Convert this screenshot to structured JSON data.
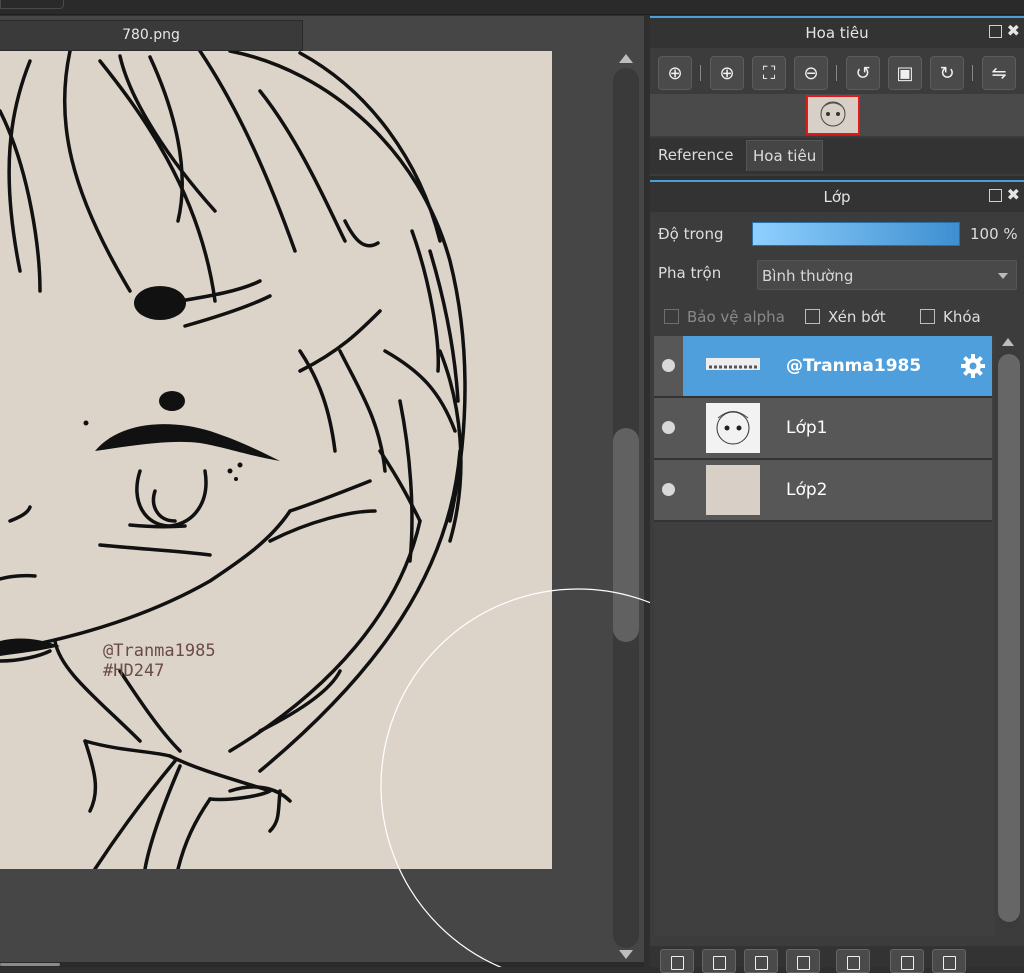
{
  "document": {
    "tab_title": "780.png",
    "canvas_watermark_line1": "@Tranma1985",
    "canvas_watermark_line2": "#HD247"
  },
  "navigator": {
    "title": "Hoa tiêu",
    "toolbar_icons": [
      "zoom-actual-icon",
      "zoom-in-icon",
      "fit-window-icon",
      "zoom-out-icon",
      "rotate-left-icon",
      "fit-canvas-icon",
      "rotate-right-icon",
      "flip-horizontal-icon"
    ],
    "tabs": [
      "Reference",
      "Hoa tiêu"
    ],
    "active_tab": "Hoa tiêu"
  },
  "layers_panel": {
    "title": "Lớp",
    "opacity_label": "Độ trong",
    "opacity_value": "100 %",
    "opacity_fraction": 1.0,
    "blend_label": "Pha trộn",
    "blend_value": "Bình thường",
    "protect_alpha_label": "Bảo vệ alpha",
    "clipping_label": "Xén bớt",
    "lock_label": "Khóa",
    "layers": [
      {
        "name": "@Tranma1985",
        "selected": true
      },
      {
        "name": "Lớp1",
        "selected": false
      },
      {
        "name": "Lớp2",
        "selected": false
      }
    ]
  },
  "colors": {
    "accent": "#4f9fdc",
    "canvas_bg": "#dcd4c8",
    "ink": "#111111",
    "watermark": "#6b4a4a",
    "thumb_highlight": "#e01a1a"
  }
}
